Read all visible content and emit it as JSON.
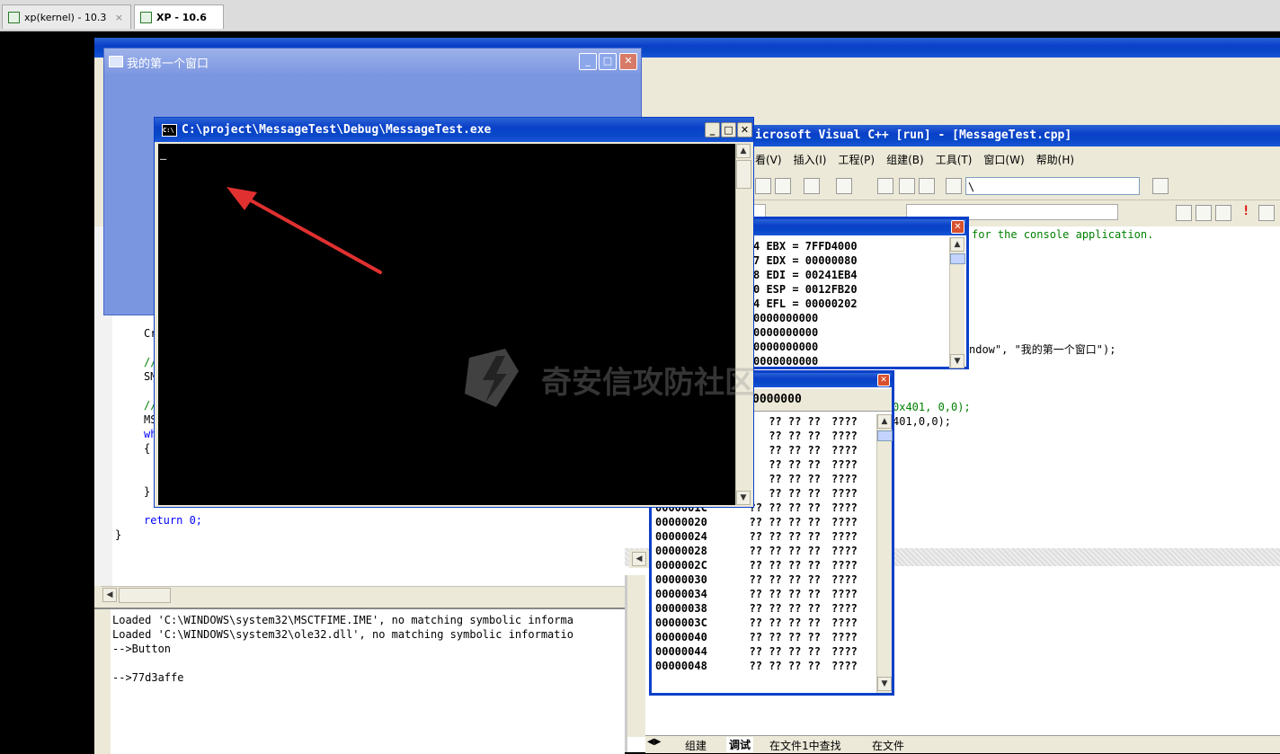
{
  "host_tabs": [
    {
      "label": "xp(kernel) - 10.3",
      "close": "×"
    },
    {
      "label": "XP - 10.6",
      "close": "×"
    }
  ],
  "first_window": {
    "title": "我的第一个窗口",
    "min": "_",
    "max": "□",
    "close": "✕"
  },
  "vc": {
    "title": "icrosoft Visual C++ [run] - [MessageTest.cpp]",
    "menu": [
      "看(V)",
      "插入(I)",
      "工程(P)",
      "组建(B)",
      "工具(T)",
      "窗口(W)",
      "帮助(H)"
    ],
    "combo_value": "\\",
    "code_right": [
      {
        "text": "for the console application.",
        "cls": "cm"
      },
      {
        "text": "ndow\", \"我的第一个窗口\");",
        "cls": ""
      },
      {
        "text": "0x401, 0,0);",
        "cls": "cm"
      },
      {
        "text": "401,0,0);",
        "cls": ""
      }
    ],
    "code_left": [
      {
        "text": "Cr",
        "cls": ""
      },
      {
        "text": "//",
        "cls": "cm"
      },
      {
        "text": "SM",
        "cls": ""
      },
      {
        "text": "//",
        "cls": "cm"
      },
      {
        "text": "MS",
        "cls": ""
      },
      {
        "text": "wh",
        "cls": "kw"
      },
      {
        "text": "{",
        "cls": ""
      },
      {
        "text": "}",
        "cls": ""
      },
      {
        "text": "return 0;",
        "cls": "kw_ret"
      },
      {
        "text": "}",
        "cls": ""
      }
    ],
    "output_lines": [
      "Loaded 'C:\\WINDOWS\\system32\\MSCTFIME.IME', no matching symbolic informa",
      "Loaded 'C:\\WINDOWS\\system32\\ole32.dll', no matching symbolic informatio",
      "-->Button",
      "",
      "-->77d3affe"
    ],
    "bottom_tabs": [
      "组建",
      "调试",
      "在文件1中查找",
      "在文件"
    ]
  },
  "registers": {
    "rows": [
      "4 EBX = 7FFD4000",
      "7 EDX = 00000080",
      "8 EDI = 00241EB4",
      "0 ESP = 0012FB20",
      "4 EFL = 00000202",
      "0000000000",
      "0000000000",
      "0000000000",
      "0000000000"
    ]
  },
  "memory": {
    "address_value": "0000000",
    "rows": [
      {
        "addr": "",
        "bytes": "?? ?? ??",
        "ascii": "????"
      },
      {
        "addr": "",
        "bytes": "?? ?? ??",
        "ascii": "????"
      },
      {
        "addr": "",
        "bytes": "?? ?? ??",
        "ascii": "????"
      },
      {
        "addr": "",
        "bytes": "?? ?? ??",
        "ascii": "????"
      },
      {
        "addr": "",
        "bytes": "?? ?? ??",
        "ascii": "????"
      },
      {
        "addr": "",
        "bytes": "?? ?? ??",
        "ascii": "????"
      },
      {
        "addr": "0000001C",
        "bytes": "?? ?? ?? ??",
        "ascii": "????"
      },
      {
        "addr": "00000020",
        "bytes": "?? ?? ?? ??",
        "ascii": "????"
      },
      {
        "addr": "00000024",
        "bytes": "?? ?? ?? ??",
        "ascii": "????"
      },
      {
        "addr": "00000028",
        "bytes": "?? ?? ?? ??",
        "ascii": "????"
      },
      {
        "addr": "0000002C",
        "bytes": "?? ?? ?? ??",
        "ascii": "????"
      },
      {
        "addr": "00000030",
        "bytes": "?? ?? ?? ??",
        "ascii": "????"
      },
      {
        "addr": "00000034",
        "bytes": "?? ?? ?? ??",
        "ascii": "????"
      },
      {
        "addr": "00000038",
        "bytes": "?? ?? ?? ??",
        "ascii": "????"
      },
      {
        "addr": "0000003C",
        "bytes": "?? ?? ?? ??",
        "ascii": "????"
      },
      {
        "addr": "00000040",
        "bytes": "?? ?? ?? ??",
        "ascii": "????"
      },
      {
        "addr": "00000044",
        "bytes": "?? ?? ?? ??",
        "ascii": "????"
      },
      {
        "addr": "00000048",
        "bytes": "?? ?? ?? ??",
        "ascii": "????"
      }
    ]
  },
  "console": {
    "title": "C:\\project\\MessageTest\\Debug\\MessageTest.exe",
    "cursor": "_",
    "min": "_",
    "max": "□",
    "close": "✕"
  },
  "watermark": {
    "text": "奇安信攻防社区"
  },
  "colors": {
    "xp_blue": "#0a40c8",
    "window_client": "#7b96e0",
    "console_bg": "#000000",
    "arrow": "#e03030"
  }
}
